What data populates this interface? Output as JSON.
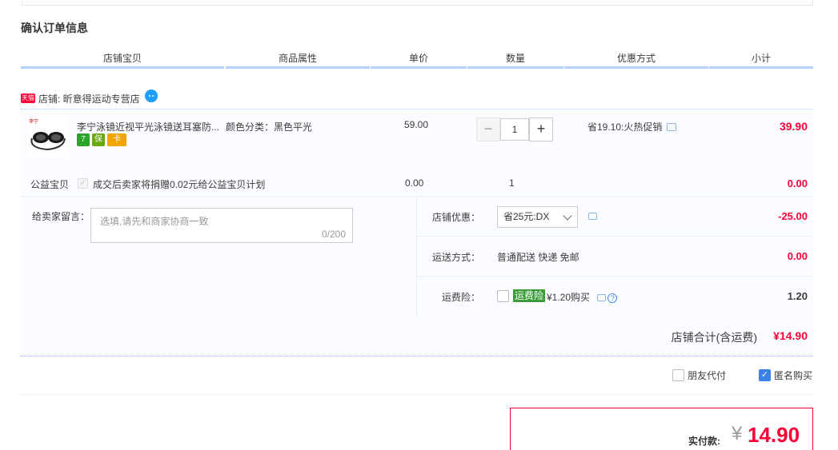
{
  "section_title": "确认订单信息",
  "columns": [
    "店铺宝贝",
    "商品属性",
    "单价",
    "数量",
    "优惠方式",
    "小计"
  ],
  "shop": {
    "badge": "天猫",
    "label": "店铺: 昕意得运动专营店",
    "ww_icon": "chat-bubble-icon"
  },
  "item": {
    "title": "李宁泳镜近视平光泳镜送耳塞防...",
    "attr": "颜色分类：黑色平光",
    "price": "59.00",
    "quantity": "1",
    "qty_minus": "−",
    "qty_plus": "+",
    "promo": "省19.10:火热促销",
    "subtotal": "39.90",
    "badges": [
      "7",
      "保",
      "卡"
    ]
  },
  "charity": {
    "label": "公益宝贝",
    "check": "✓",
    "text": "成交后卖家将捐赠0.02元给公益宝贝计划",
    "price": "0.00",
    "qty": "1",
    "subtotal": "0.00"
  },
  "message": {
    "label": "给卖家留言：",
    "placeholder": "选填,请先和商家协商一致",
    "counter": "0/200"
  },
  "options": {
    "discount_label": "店铺优惠：",
    "discount_value": "省25元:DX",
    "discount_amount": "-25.00",
    "shipping_label": "运送方式：",
    "shipping_value": "普通配送 快递 免邮",
    "shipping_amount": "0.00",
    "insurance_label": "运费险：",
    "insurance_tag": "运费险",
    "insurance_text": "¥1.20购买",
    "insurance_help": "?",
    "insurance_amount": "1.20"
  },
  "shop_total": {
    "label": "店铺合计(含运费)",
    "amount": "¥14.90"
  },
  "extras": {
    "friend_pay": "朋友代付",
    "anonymous": "匿名购买",
    "anonymous_checked": "✓"
  },
  "payment": {
    "label": "实付款:",
    "yen": "¥",
    "amount": "14.90"
  },
  "colors": {
    "accent_red": "#ff0036",
    "header_line": "#b2d1ff",
    "checkbox_blue": "#3c80e8",
    "insurance_green": "#3a9d3a"
  }
}
